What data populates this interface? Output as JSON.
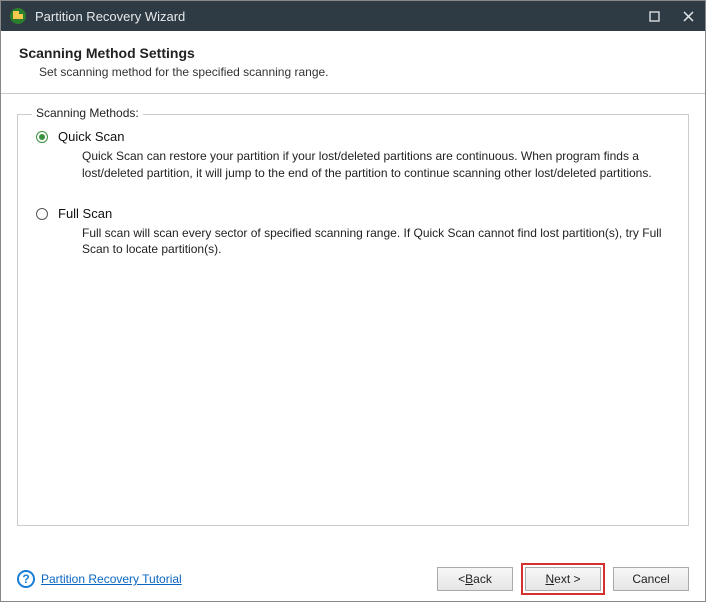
{
  "titlebar": {
    "title": "Partition Recovery Wizard"
  },
  "header": {
    "title": "Scanning Method Settings",
    "subtitle": "Set scanning method for the specified scanning range."
  },
  "fieldset": {
    "legend": "Scanning Methods:"
  },
  "options": {
    "quick": {
      "label": "Quick Scan",
      "description": "Quick Scan can restore your partition if your lost/deleted partitions are continuous. When program finds a lost/deleted partition, it will jump to the end of the partition to continue scanning other lost/deleted partitions.",
      "selected": true
    },
    "full": {
      "label": "Full Scan",
      "description": "Full scan will scan every sector of specified scanning range. If Quick Scan cannot find lost partition(s), try Full Scan to locate partition(s).",
      "selected": false
    }
  },
  "footer": {
    "help_link": "Partition Recovery Tutorial",
    "back_prefix": "< ",
    "back_u": "B",
    "back_suffix": "ack",
    "next_u": "N",
    "next_suffix": "ext >",
    "cancel": "Cancel"
  }
}
